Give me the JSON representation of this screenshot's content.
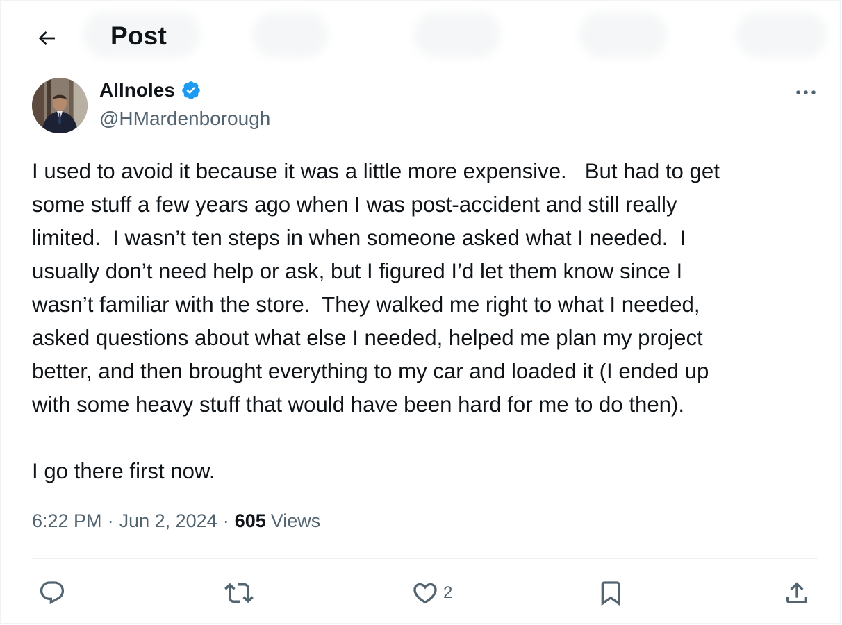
{
  "header": {
    "title": "Post"
  },
  "post": {
    "author": {
      "display_name": "Allnoles",
      "handle": "@HMardenborough",
      "verified": true
    },
    "text": "I used to avoid it because it was a little more expensive.   But had to get\nsome stuff a few years ago when I was post-accident and still really\nlimited.  I wasn’t ten steps in when someone asked what I needed.  I\nusually don’t need help or ask, but I figured I’d let them know since I\nwasn’t familiar with the store.  They walked me right to what I needed,\nasked questions about what else I needed, helped me plan my project\nbetter, and then brought everything to my car and loaded it (I ended up\nwith some heavy stuff that would have been hard for me to do then).\n\nI go there first now.",
    "time": "6:22 PM",
    "dot1": "·",
    "date": "Jun 2, 2024",
    "dot2": "·",
    "views_count": "605",
    "views_label": "Views"
  },
  "actions": {
    "reply": {
      "icon": "reply-icon",
      "count": ""
    },
    "repost": {
      "icon": "repost-icon",
      "count": ""
    },
    "like": {
      "icon": "heart-icon",
      "count": "2"
    },
    "bookmark": {
      "icon": "bookmark-icon",
      "count": ""
    },
    "share": {
      "icon": "share-icon",
      "count": ""
    }
  },
  "colors": {
    "text": "#0f1419",
    "secondary": "#536471",
    "verified": "#1d9bf0",
    "divider": "#eff3f4"
  }
}
